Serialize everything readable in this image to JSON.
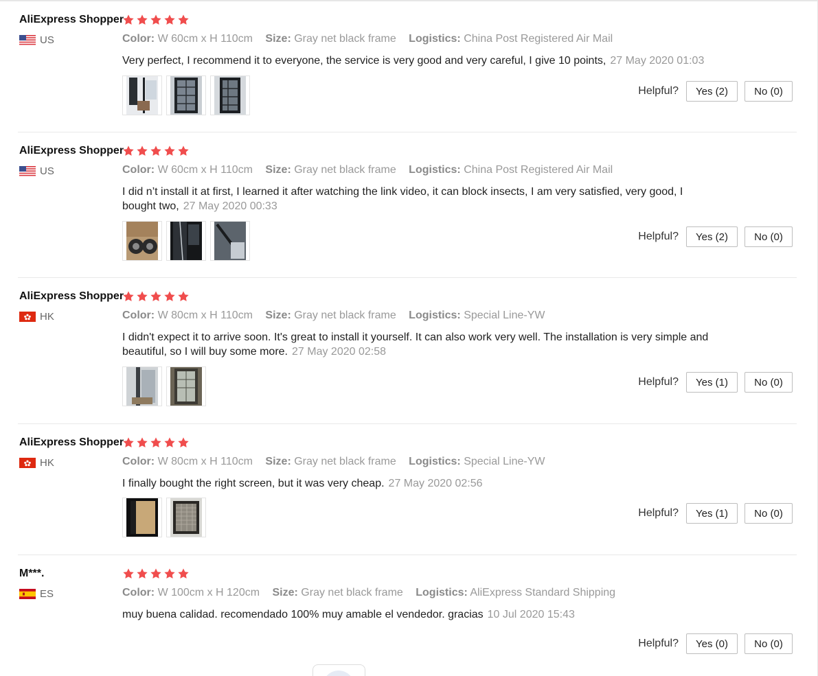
{
  "helpful_label": "Helpful?",
  "colors": {
    "star": "#f04d4d",
    "accent": "#ff4747"
  },
  "labels": {
    "color": "Color:",
    "size": "Size:",
    "logistics": "Logistics:"
  },
  "reviews": [
    {
      "user": "AliExpress Shopper",
      "country": "US",
      "flag": "us-flag-icon",
      "rating": 5,
      "color": "W 60cm x H 110cm",
      "size": "Gray net black frame",
      "logistics": "China Post Registered Air Mail",
      "text": "Very perfect, I recommend it to everyone, the service is very good and very careful, I give 10 points,",
      "date": "27 May 2020 01:03",
      "yes": "Yes (2)",
      "no": "No (0)"
    },
    {
      "user": "AliExpress Shopper",
      "country": "US",
      "flag": "us-flag-icon",
      "rating": 5,
      "color": "W 60cm x H 110cm",
      "size": "Gray net black frame",
      "logistics": "China Post Registered Air Mail",
      "text": "I did n’t install it at first, I learned it after watching the link video, it can block insects, I am very satisfied, very good, I bought two,",
      "date": "27 May 2020 00:33",
      "yes": "Yes (2)",
      "no": "No (0)"
    },
    {
      "user": "AliExpress Shopper",
      "country": "HK",
      "flag": "hk-flag-icon",
      "rating": 5,
      "color": "W 80cm x H 110cm",
      "size": "Gray net black frame",
      "logistics": "Special Line-YW",
      "text": "I didn't expect it to arrive soon. It's great to install it yourself. It can also work very well. The installation is very simple and beautiful, so I will buy some more.",
      "date": "27 May 2020 02:58",
      "yes": "Yes (1)",
      "no": "No (0)"
    },
    {
      "user": "AliExpress Shopper",
      "country": "HK",
      "flag": "hk-flag-icon",
      "rating": 5,
      "color": "W 80cm x H 110cm",
      "size": "Gray net black frame",
      "logistics": "Special Line-YW",
      "text": "I finally bought the right screen, but it was very cheap.",
      "date": "27 May 2020 02:56",
      "yes": "Yes (1)",
      "no": "No (0)"
    },
    {
      "user": "M***.",
      "country": "ES",
      "flag": "es-flag-icon",
      "rating": 5,
      "color": "W 100cm x H 120cm",
      "size": "Gray net black frame",
      "logistics": "AliExpress Standard Shipping",
      "text": "muy buena calidad. recomendado 100% muy amable el vendedor. gracias",
      "date": "10 Jul 2020 15:43",
      "yes": "Yes (0)",
      "no": "No (0)"
    }
  ]
}
